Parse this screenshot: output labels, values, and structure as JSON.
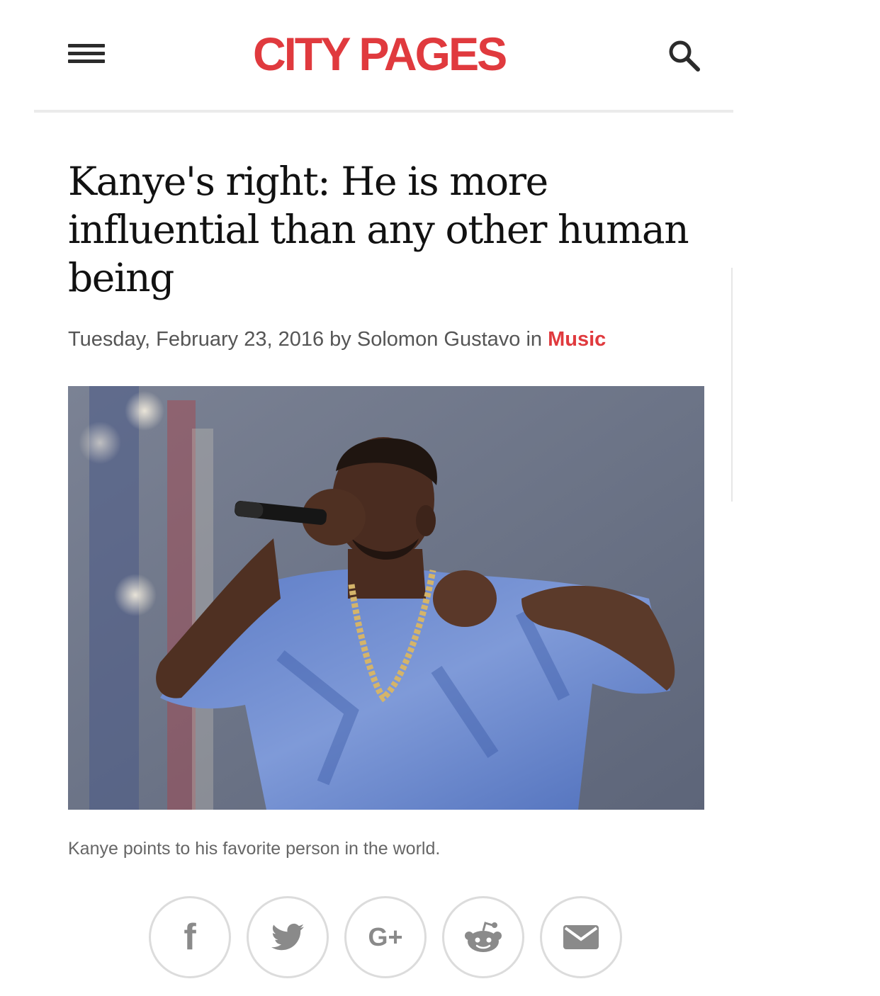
{
  "header": {
    "logo_text": "CITY PAGES",
    "menu_icon": "hamburger-menu-icon",
    "search_icon": "search-icon"
  },
  "article": {
    "headline": "Kanye's right: He is more influential than any other human being",
    "date": "Tuesday, February 23, 2016",
    "by_word": "by",
    "author": "Solomon Gustavo",
    "in_word": "in",
    "category": "Music",
    "caption": "Kanye points to his favorite person in the world."
  },
  "share": {
    "buttons": [
      {
        "icon": "facebook-icon",
        "glyph": "f"
      },
      {
        "icon": "twitter-icon"
      },
      {
        "icon": "google-plus-icon",
        "glyph": "G+"
      },
      {
        "icon": "reddit-icon"
      },
      {
        "icon": "email-icon"
      }
    ]
  },
  "colors": {
    "brand": "#e03a3e",
    "text": "#111111",
    "muted": "#555555",
    "icon": "#8a8a8a"
  }
}
